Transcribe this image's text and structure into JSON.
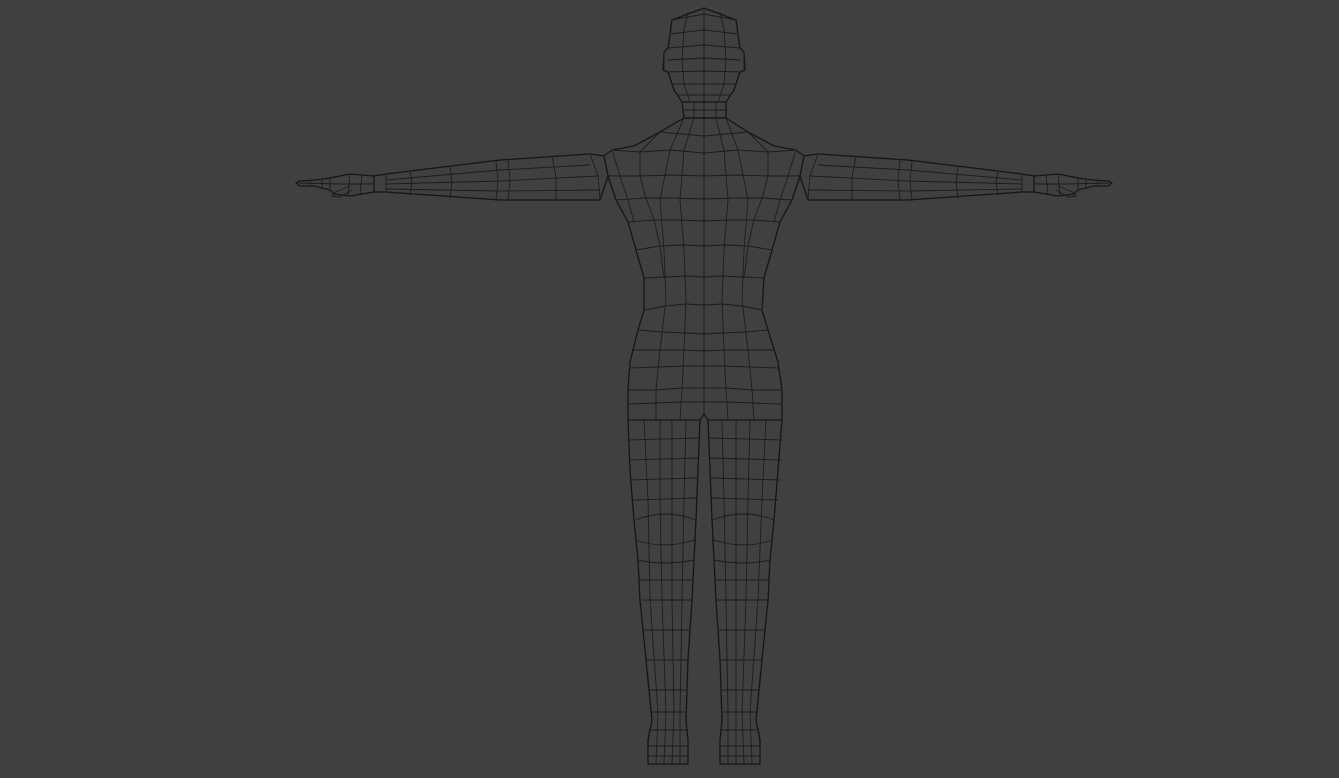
{
  "viewport": {
    "background_color": "#404040",
    "wire_color": "#1c1c1c",
    "shading": "wireframe",
    "view": "front",
    "object": {
      "icon": "humanoid-mesh-icon",
      "pose": "t-pose"
    }
  }
}
